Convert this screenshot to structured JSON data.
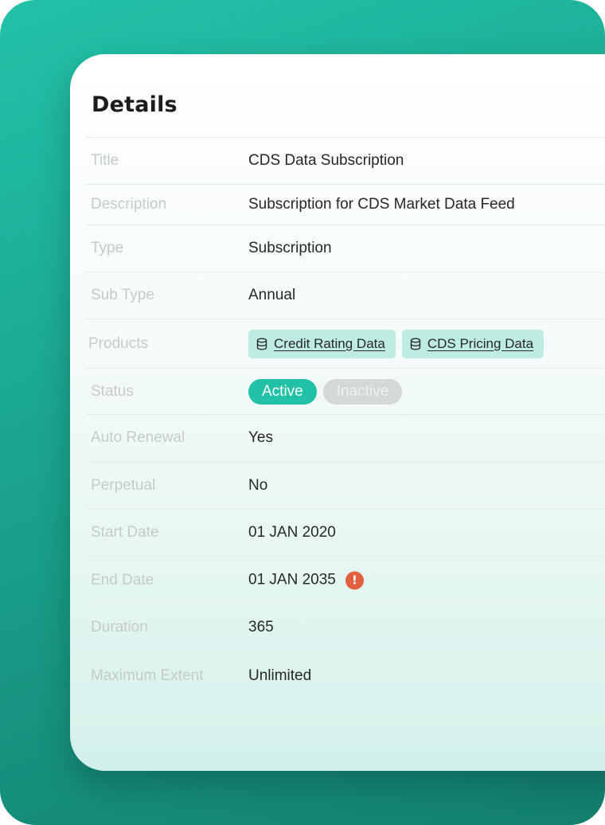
{
  "card": {
    "title": "Details"
  },
  "rows": [
    {
      "label": "Title",
      "value": "CDS Data Subscription"
    },
    {
      "label": "Description",
      "value": "Subscription for CDS Market Data Feed"
    },
    {
      "label": "Type",
      "value": "Subscription"
    },
    {
      "label": "Sub Type",
      "value": "Annual"
    },
    {
      "label": "Products",
      "chips": [
        {
          "label": "Credit Rating Data",
          "icon": "database-icon"
        },
        {
          "label": "CDS Pricing Data",
          "icon": "database-icon"
        }
      ]
    },
    {
      "label": "Status",
      "options": [
        "Active",
        "Inactive"
      ],
      "selected": "Active"
    },
    {
      "label": "Auto Renewal",
      "value": "Yes"
    },
    {
      "label": "Perpetual",
      "value": "No"
    },
    {
      "label": "Start Date",
      "value": "01 JAN 2020"
    },
    {
      "label": "End Date",
      "value": "01 JAN 2035",
      "icon": "warning-icon",
      "icon_glyph": "!"
    },
    {
      "label": "Duration",
      "value": "365"
    },
    {
      "label": "Maximum Extent",
      "value": "Unlimited"
    }
  ],
  "colors": {
    "frame_gradient_start": "#22c2a8",
    "frame_gradient_end": "#137f6f",
    "chip_background": "#bfece2",
    "status_active": "#22c2a8",
    "status_inactive": "#d4d9d8",
    "warning": "#e2603f"
  }
}
